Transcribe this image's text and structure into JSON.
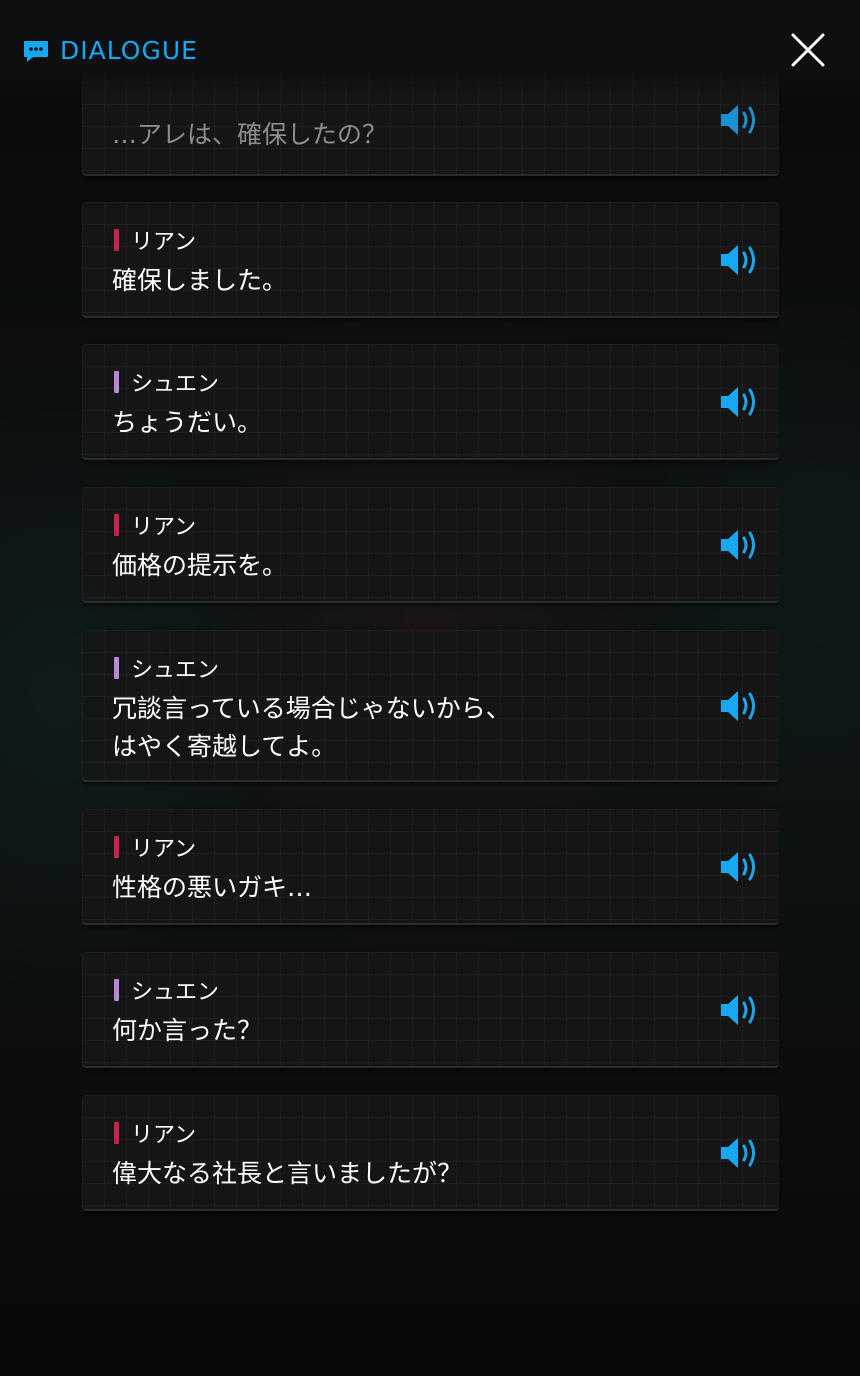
{
  "header": {
    "title": "DIALOGUE",
    "chat_icon": "chat-bubble-icon",
    "close_icon": "close-icon"
  },
  "colors": {
    "accent": "#16a8f0",
    "speaker_riann": "#c8234a",
    "speaker_shuen": "#b886d6",
    "faded_text": "#8c8d8f"
  },
  "dialogue": [
    {
      "speaker": "",
      "text": "…アレは、確保したの？",
      "faded": true
    },
    {
      "speaker": "リアン",
      "text": "確保しました。"
    },
    {
      "speaker": "シュエン",
      "text": "ちょうだい。"
    },
    {
      "speaker": "リアン",
      "text": "価格の提示を。"
    },
    {
      "speaker": "シュエン",
      "text": "冗談言っている場合じゃないから、\nはやく寄越してよ。"
    },
    {
      "speaker": "リアン",
      "text": "性格の悪いガキ…"
    },
    {
      "speaker": "シュエン",
      "text": "何か言った？"
    },
    {
      "speaker": "リアン",
      "text": "偉大なる社長と言いましたが？"
    }
  ]
}
